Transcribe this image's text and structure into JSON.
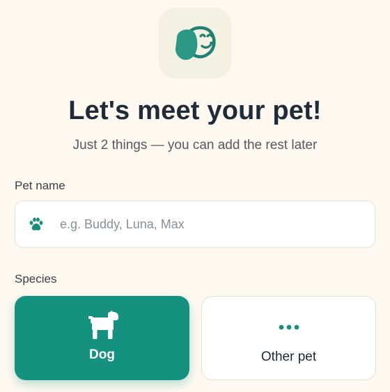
{
  "header": {
    "title": "Let's meet your pet!",
    "subtitle": "Just 2 things — you can add the rest later"
  },
  "pet_name": {
    "label": "Pet name",
    "placeholder": "e.g. Buddy, Luna, Max",
    "value": "",
    "icon": "paw-icon"
  },
  "species": {
    "label": "Species",
    "selected": "Dog",
    "options": [
      {
        "label": "Dog",
        "icon": "dog-icon",
        "selected": true
      },
      {
        "label": "Other pet",
        "icon": "more-dots-icon",
        "selected": false
      }
    ]
  },
  "colors": {
    "accent": "#14917f",
    "background": "#fdf9f1",
    "logo_tile": "#f3f1e2"
  }
}
